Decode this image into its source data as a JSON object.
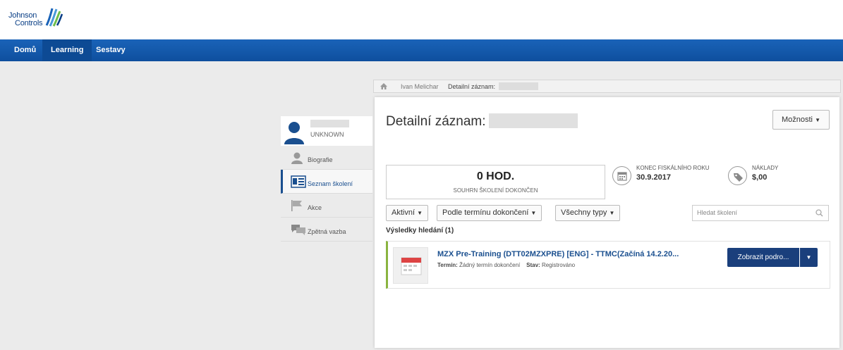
{
  "header": {
    "logo_line1": "Johnson",
    "logo_line2": "Controls"
  },
  "nav": {
    "items": [
      {
        "label": "Domů"
      },
      {
        "label": "Learning"
      },
      {
        "label": "Sestavy"
      }
    ]
  },
  "breadcrumb": {
    "items": [
      "Ivan Melichar",
      "Detailní záznam:"
    ]
  },
  "user": {
    "name": "UNKNOWN"
  },
  "sidebar": {
    "items": [
      {
        "label": "Biografie",
        "icon": "person-icon"
      },
      {
        "label": "Seznam školení",
        "icon": "transcript-icon"
      },
      {
        "label": "Akce",
        "icon": "flag-icon"
      },
      {
        "label": "Zpětná vazba",
        "icon": "feedback-icon"
      }
    ],
    "active": "Seznam školení"
  },
  "main": {
    "title": "Detailní záznam:",
    "options_label": "Možnosti",
    "stat_value": "0 HOD.",
    "stat_label": "SOUHRN ŠKOLENÍ DOKONČEN",
    "fiscal_label": "KONEC FISKÁLNÍHO ROKU",
    "fiscal_value": "30.9.2017",
    "cost_label": "NÁKLADY",
    "cost_value": "$,00",
    "filters": [
      "Aktivní",
      "Podle termínu dokončení",
      "Všechny typy"
    ],
    "search_placeholder": "Hledat školení",
    "results_label": "Výsledky hledání (1)"
  },
  "result": {
    "title": "MZX Pre-Training (DTT02MZXPRE) [ENG] - TTMC(Začíná 14.2.20...",
    "term_label": "Termín:",
    "term_value": "Žádný termín dokončení",
    "status_label": "Stav:",
    "status_value": "Registrováno",
    "action_label": "Zobrazit podro...",
    "icon": "calendar-icon"
  },
  "colors": {
    "nav_bg": "#1a63b8",
    "primary_button": "#1a3f7c",
    "accent_green": "#8ab43f",
    "link": "#1a4f8f"
  }
}
